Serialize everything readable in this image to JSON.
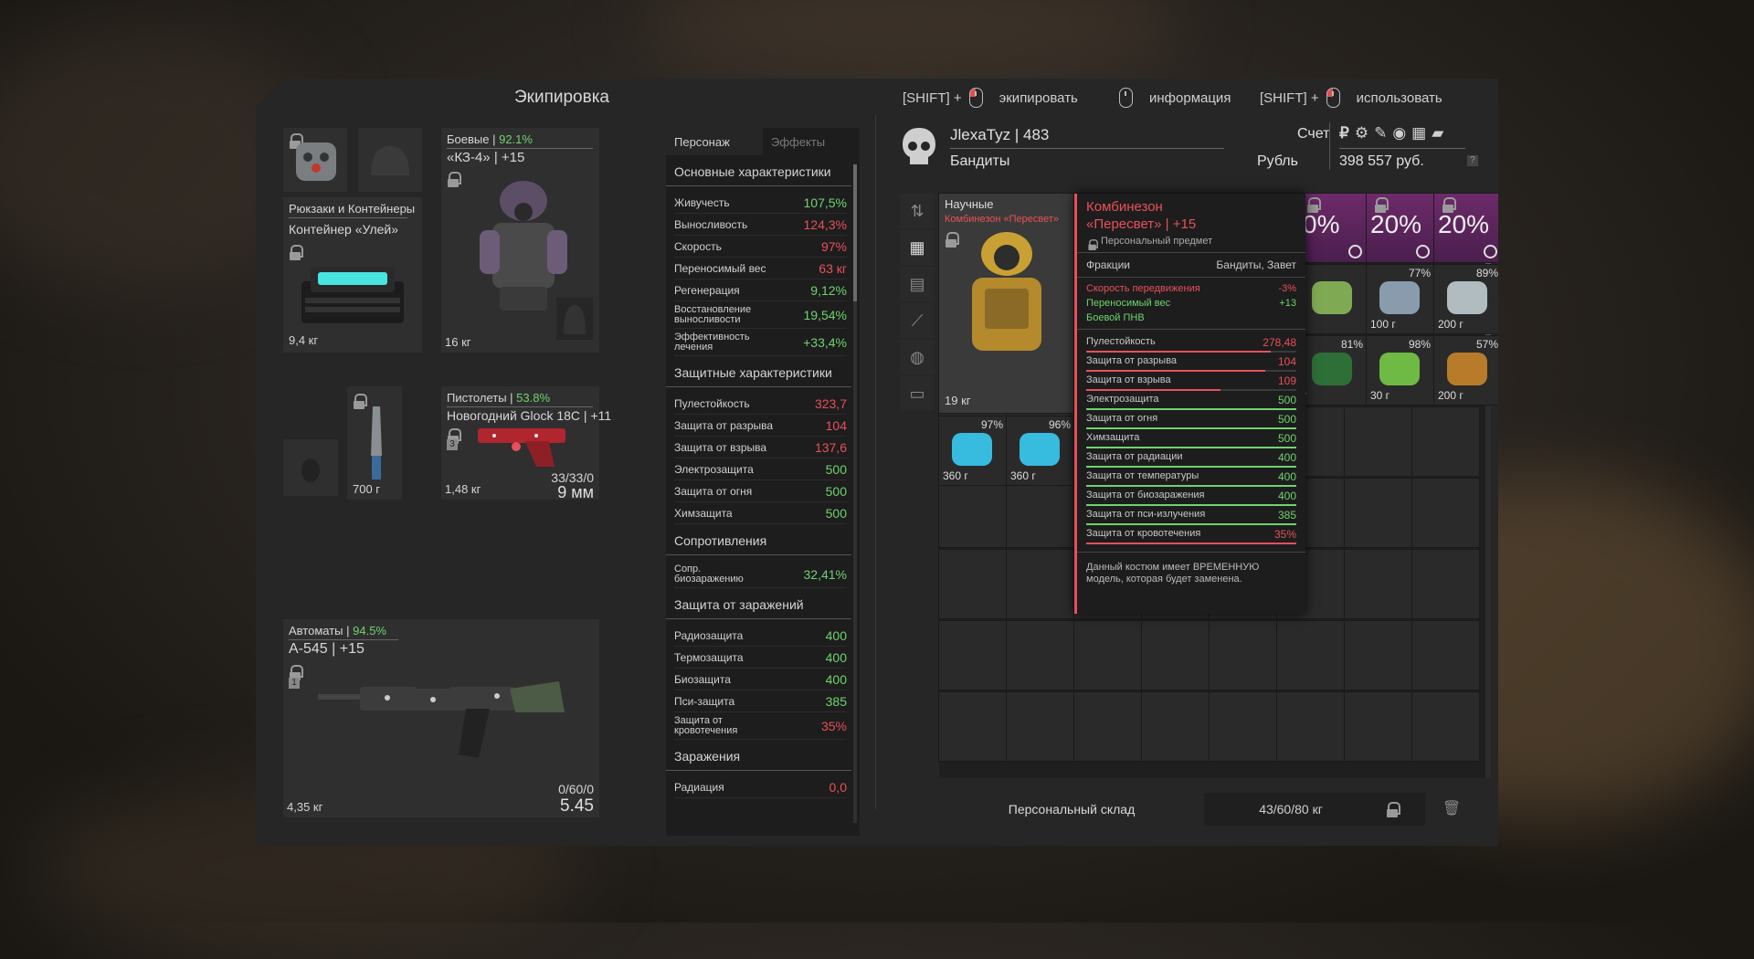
{
  "window": {
    "title": "Экипировка"
  },
  "hints": [
    {
      "prefix": "[SHIFT] +",
      "label": "экипировать"
    },
    {
      "prefix": "",
      "label": "информация"
    },
    {
      "prefix": "[SHIFT] +",
      "label": "использовать"
    }
  ],
  "player": {
    "name": "JlexaTyz | 483",
    "faction": "Бандиты",
    "account_label": "Счет",
    "currency_label": "Рубль",
    "balance": "398 557 руб.",
    "help": "?"
  },
  "equipment": {
    "backpack": {
      "category": "Рюкзаки и Контейнеры",
      "name": "Контейнер «Улей»",
      "weight": "9,4 кг"
    },
    "armor": {
      "category": "Боевые |",
      "durability": "92.1%",
      "name": "«КЗ-4» | +15",
      "weight": "16 кг"
    },
    "melee": {
      "weight": "700 г"
    },
    "pistol": {
      "category": "Пистолеты |",
      "durability": "53.8%",
      "name": "Новогодний Glock 18C | +11",
      "weight": "1,48 кг",
      "ammo": "33/33/0",
      "caliber": "9 мм",
      "badge": "3"
    },
    "rifle": {
      "category": "Автоматы |",
      "durability": "94.5%",
      "name": "А-545 | +15",
      "weight": "4,35 кг",
      "ammo": "0/60/0",
      "caliber": "5.45",
      "badge": "1"
    }
  },
  "stats": {
    "tabs": [
      "Персонаж",
      "Эффекты"
    ],
    "sections": [
      {
        "title": "Основные характеристики",
        "rows": [
          {
            "k": "Живучесть",
            "v": "107,5%",
            "c": "green"
          },
          {
            "k": "Выносливость",
            "v": "124,3%",
            "c": "red"
          },
          {
            "k": "Скорость",
            "v": "97%",
            "c": "red"
          },
          {
            "k": "Переносимый вес",
            "v": "63 кг",
            "c": "red"
          },
          {
            "k": "Регенерация",
            "v": "9,12%",
            "c": "green"
          },
          {
            "k": "Восстановление выносливости",
            "v": "19,54%",
            "c": "green",
            "two": true
          },
          {
            "k": "Эффективность лечения",
            "v": "+33,4%",
            "c": "green",
            "two": true
          }
        ]
      },
      {
        "title": "Защитные характеристики",
        "rows": [
          {
            "k": "Пулестойкость",
            "v": "323,7",
            "c": "red"
          },
          {
            "k": "Защита от разрыва",
            "v": "104",
            "c": "red"
          },
          {
            "k": "Защита от взрыва",
            "v": "137,6",
            "c": "red"
          },
          {
            "k": "Электрозащита",
            "v": "500",
            "c": "green"
          },
          {
            "k": "Защита от огня",
            "v": "500",
            "c": "green"
          },
          {
            "k": "Химзащита",
            "v": "500",
            "c": "green"
          }
        ]
      },
      {
        "title": "Сопротивления",
        "rows": [
          {
            "k": "Сопр. биозаражению",
            "v": "32,41%",
            "c": "green",
            "two": true
          }
        ]
      },
      {
        "title": "Защита от заражений",
        "rows": [
          {
            "k": "Радиозащита",
            "v": "400",
            "c": "green"
          },
          {
            "k": "Термозащита",
            "v": "400",
            "c": "green"
          },
          {
            "k": "Биозащита",
            "v": "400",
            "c": "green"
          },
          {
            "k": "Пси-защита",
            "v": "385",
            "c": "green"
          },
          {
            "k": "Защита от кровотечения",
            "v": "35%",
            "c": "red",
            "two": true
          }
        ]
      },
      {
        "title": "Заражения",
        "rows": [
          {
            "k": "Радиация",
            "v": "0,0",
            "c": "red"
          }
        ]
      }
    ]
  },
  "inventory": {
    "suit_cell": {
      "category": "Научные",
      "name": "Комбинезон «Пересвет»",
      "weight": "19 кг"
    },
    "cells": [
      {
        "pct": "97%",
        "w": "360 г"
      },
      {
        "pct": "96%",
        "w": "360 г"
      },
      {
        "pct": "0%",
        "big": true
      },
      {
        "pct": "20%",
        "big": true
      },
      {
        "pct": "20%",
        "big": true
      },
      {
        "w": ""
      },
      {
        "pct": "77%",
        "w": "100 г"
      },
      {
        "pct": "89%",
        "w": "200 г"
      },
      {
        "pct": "81%",
        "w": "г"
      },
      {
        "pct": "98%",
        "w": "30 г"
      },
      {
        "pct": "57%",
        "w": "200 г"
      }
    ],
    "storage_label": "Персональный склад",
    "storage_weight": "43/60/80 кг"
  },
  "tooltip": {
    "title": "Комбинезон",
    "subtitle": "«Пересвет» | +15",
    "personal": "Персональный предмет",
    "factions_label": "Фракции",
    "factions_value": "Бандиты, Завет",
    "mods": [
      {
        "k": "Скорость передвижения",
        "v": "-3%",
        "c": "red"
      },
      {
        "k": "Переносимый вес",
        "v": "+13",
        "c": "green"
      },
      {
        "k": "Боевой ПНВ",
        "v": "",
        "c": "green"
      }
    ],
    "rows": [
      {
        "k": "Пулестойкость",
        "v": "278,48",
        "c": "red",
        "bar": 0.88
      },
      {
        "k": "Защита от разрыва",
        "v": "104",
        "c": "red",
        "bar": 0.85
      },
      {
        "k": "Защита от взрыва",
        "v": "109",
        "c": "red",
        "bar": 0.64
      },
      {
        "k": "Электрозащита",
        "v": "500",
        "c": "green",
        "bar": 1.0
      },
      {
        "k": "Защита от огня",
        "v": "500",
        "c": "green",
        "bar": 1.0
      },
      {
        "k": "Химзащита",
        "v": "500",
        "c": "green",
        "bar": 1.0
      },
      {
        "k": "Защита от радиации",
        "v": "400",
        "c": "green",
        "bar": 1.0
      },
      {
        "k": "Защита от температуры",
        "v": "400",
        "c": "green",
        "bar": 1.0
      },
      {
        "k": "Защита от биозаражения",
        "v": "400",
        "c": "green",
        "bar": 1.0
      },
      {
        "k": "Защита от пси-излучения",
        "v": "385",
        "c": "green",
        "bar": 1.0
      },
      {
        "k": "Защита от кровотечения",
        "v": "35%",
        "c": "red",
        "bar": 1.0
      }
    ],
    "note": "Данный костюм имеет ВРЕМЕННУЮ модель, которая будет заменена."
  },
  "colors": {
    "green": "#6fd36f",
    "red": "#e8505a",
    "purple": "#6d2a6a"
  }
}
